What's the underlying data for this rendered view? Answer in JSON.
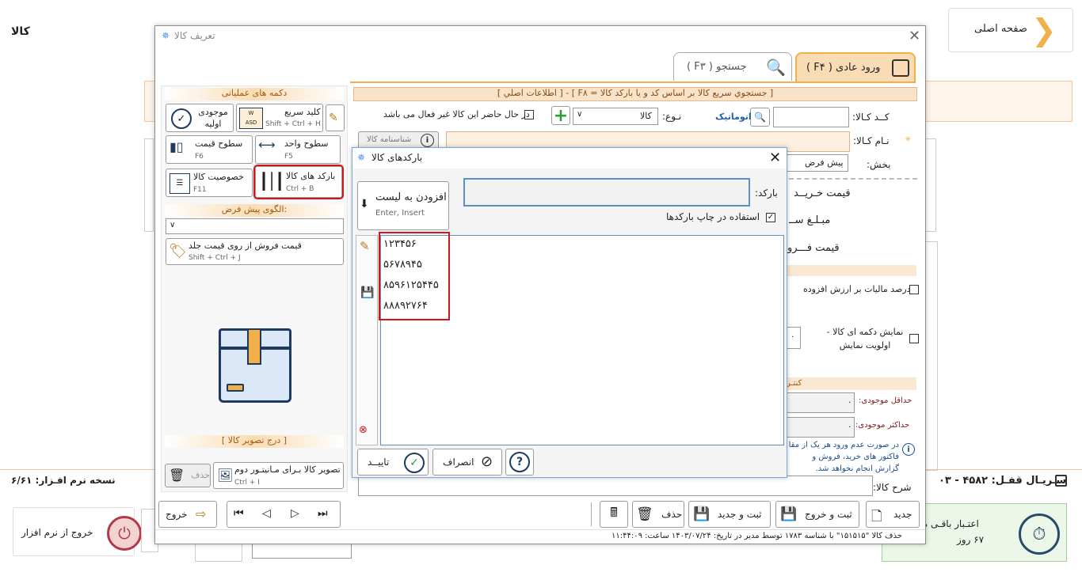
{
  "page_title": "کالا",
  "home_button": "صفحه اصلی",
  "version_label": "نسخه نرم افـزار: ۶/۶۱",
  "lock_serial": "سـریـال قفـل: ۴۵۸۲ - ۰۳",
  "exit_app": "خروج از نرم افزار",
  "credit": {
    "label": "اعتـبار باقـی مانـد",
    "days": "۶۷ روز"
  },
  "product_window": {
    "title": "تعریف کالا",
    "tabs": [
      "ورود عادی ( F۴ )",
      "جستجو ( F۳ )"
    ],
    "quick_search": "[ جستجوي سريع كالا بر اساس كد و يا باركد كالا = F۸ ] - [ اطلاعات اصلي ]",
    "code_label": "کــد کـالا:",
    "auto_label": "اتوماتیک",
    "type_label": "نـوع:",
    "type_value": "کالا",
    "inactive_label": "در حال حاضر این کالا غیر فعال می باشد",
    "name_label": "نـام کـالا:",
    "id_button": "شناسنامه کالا",
    "section_label": "بخش:",
    "section_value": "پیش فرض",
    "buy_price": "قیمت خـریــد",
    "amount": "مبـلـغ ســ",
    "sell_price": "قیمت فـــرو",
    "vat_label": "درصد مالیات بر ارزش افزوده",
    "show_btn_label": "نمایش دکمه ای کالا - اولویت نمایش",
    "priority_value": "۰",
    "control": "کنتـر",
    "min_stock": "حداقل موجودی:",
    "max_stock": "حداکثر موجودی:",
    "min_value": "۰",
    "max_value": "۰",
    "note_text": "در صورت عدم ورود هر یک از مقا فاکتور های خرید، فروش و گزارش انجام نخواهد شد.",
    "desc_label": "شرح کالا:",
    "ops_header": "دکمه های عملیاتی",
    "ops": [
      {
        "label": "موجودی اولیه",
        "sub": ""
      },
      {
        "label": "کلید سریع",
        "sub": "Shift + Ctrl + H"
      },
      {
        "label": "سطوح قیمت",
        "sub": "F6"
      },
      {
        "label": "سطوح واحد",
        "sub": "F5"
      },
      {
        "label": "خصوصیت کالا",
        "sub": "F11"
      },
      {
        "label": "بارکد های کالا",
        "sub": "Ctrl + B"
      }
    ],
    "pattern_header": "الگوی پیش فرض:",
    "sale_from_cover": {
      "label": "قیمت فروش از روی قیمت جلد",
      "sub": "Shift + Ctrl + J"
    },
    "image_header": "[ درج تصویر کالا ]",
    "second_monitor": {
      "label": "تصویر کالا بـرای مـانیتـور دوم",
      "sub": "Ctrl + I"
    },
    "delete_img": "حذف",
    "bottom": {
      "new": "جدید",
      "save_exit": "ثبت و خروج",
      "save_new": "ثبت و جدید",
      "delete": "حذف",
      "exit": "خروج"
    },
    "status": "حذف کالا \"۱۵۱۵۱۵\" با شناسه ۱۷۸۳ توسط مدیر در تاریخ: ۱۴۰۳/۰۷/۲۴ ساعت: ۱۱:۴۴:۰۹"
  },
  "barcode_dialog": {
    "title": "بارکدهای کالا",
    "barcode_label": "بارکد:",
    "add_button": "افزودن به لیست",
    "add_sub": "Enter, Insert",
    "print_label": "استفاده در چاپ بارکدها",
    "barcodes": [
      "۱۲۳۴۵۶",
      "۵۶۷۸۹۴۵",
      "۸۵۹۶۱۲۵۴۴۵",
      "۸۸۸۹۲۷۶۴"
    ],
    "ok": "تاییــد",
    "cancel": "انصراف",
    "help": "?"
  },
  "colors": {
    "accent": "#f2b04a",
    "highlight": "#d0161b",
    "dialog_border": "#7aa7d6"
  }
}
